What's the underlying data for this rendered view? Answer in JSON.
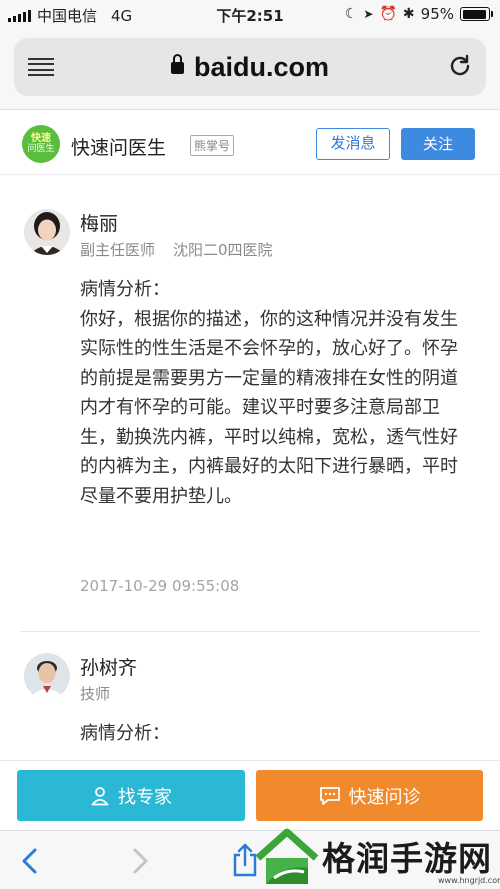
{
  "status_bar": {
    "carrier": "中国电信",
    "network": "4G",
    "time": "下午2:51",
    "battery_percent": "95%",
    "battery_level": 0.95
  },
  "browser": {
    "url": "baidu.com"
  },
  "site": {
    "logo_top": "快速",
    "logo_bottom": "问医生",
    "name": "快速问医生",
    "tag": "熊掌号",
    "message_button": "发消息",
    "follow_button": "关注"
  },
  "answers": [
    {
      "doctor": "梅丽",
      "title": "副主任医师",
      "hospital": "沈阳二0四医院",
      "heading": "病情分析：",
      "body": "你好，根据你的描述，你的这种情况并没有发生实际性的性生活是不会怀孕的，放心好了。怀孕的前提是需要男方一定量的精液排在女性的阴道内才有怀孕的可能。建议平时要多注意局部卫生，勤换洗内裤，平时以纯棉，宽松，透气性好的内裤为主，内裤最好的太阳下进行暴晒，平时尽量不要用护垫儿。",
      "time": "2017-10-29 09:55:08"
    },
    {
      "doctor": "孙树齐",
      "title": "技师",
      "heading": "病情分析："
    }
  ],
  "actions": {
    "find_expert": "找专家",
    "quick_consult": "快速问诊"
  },
  "watermark": {
    "text": "格润手游网",
    "url": "www.hngrjd.com"
  },
  "colors": {
    "follow_blue": "#3d8ae0",
    "expert_cyan": "#2bb8d4",
    "consult_orange": "#f08a2d",
    "logo_green": "#5bbd3c"
  }
}
